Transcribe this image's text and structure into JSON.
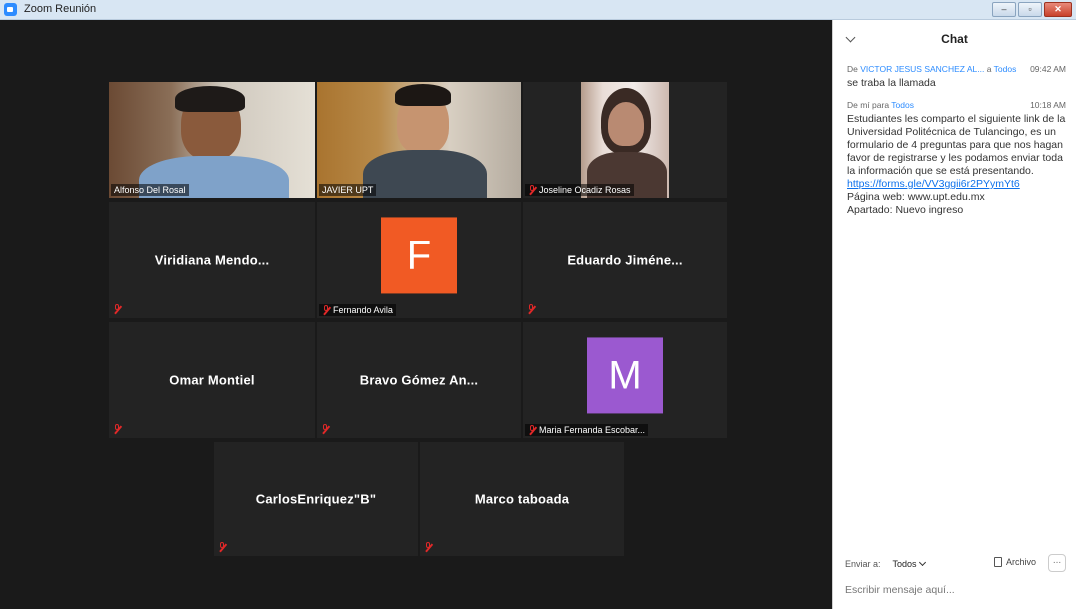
{
  "window": {
    "title": "Zoom Reunión"
  },
  "gallery": {
    "tiles": [
      {
        "name": "Alfonso Del Rosal",
        "label": "Alfonso Del Rosal"
      },
      {
        "name": "JAVIER UPT",
        "label": "JAVIER UPT"
      },
      {
        "name": "Joseline Ocadiz Rosas",
        "label": "Joseline Ocadiz Rosas"
      },
      {
        "name": "Viridiana Mendo..."
      },
      {
        "name": "Fernando Avila",
        "label": "Fernando Avila",
        "initial": "F",
        "avatar_color": "#f15a24"
      },
      {
        "name": "Eduardo Jiméne..."
      },
      {
        "name": "Omar Montiel"
      },
      {
        "name": "Bravo Gómez An..."
      },
      {
        "name": "Maria Fernanda Escobar...",
        "label": "Maria Fernanda Escobar...",
        "initial": "M",
        "avatar_color": "#9b59d0"
      },
      {
        "name": "CarlosEnriquez\"B\""
      },
      {
        "name": "Marco taboada"
      }
    ]
  },
  "chat": {
    "title": "Chat",
    "messages": [
      {
        "from_prefix": "De",
        "from": "VICTOR JESUS SANCHEZ AL...",
        "to_prefix": "a",
        "to": "Todos",
        "time": "09:42 AM",
        "text": "se traba la llamada"
      },
      {
        "from_prefix": "De mí para",
        "to": "Todos",
        "time": "10:18 AM",
        "text": "Estudiantes les comparto el siguiente link de la Universidad Politécnica de Tulancingo, es un formulario de 4 preguntas para que nos hagan favor de registrarse y les podamos enviar toda la información que se está presentando.",
        "link": "https://forms.gle/VV3ggii6r2PYymYt6",
        "line2": "Página web: www.upt.edu.mx",
        "line3": "Apartado: Nuevo ingreso"
      }
    ],
    "send_to_label": "Enviar a:",
    "recipient": "Todos",
    "file_label": "Archivo",
    "more_label": "...",
    "input_placeholder": "Escribir mensaje aquí..."
  }
}
